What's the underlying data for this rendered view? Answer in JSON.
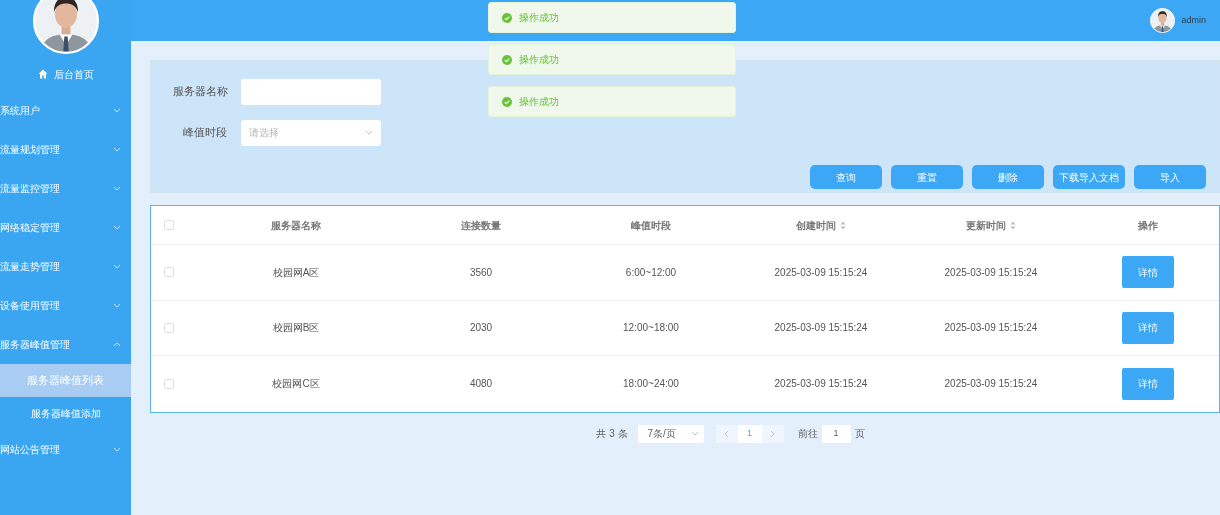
{
  "sidebar": {
    "home": "后台首页",
    "items": [
      {
        "label": "系统用户",
        "expanded": false
      },
      {
        "label": "流量规划管理",
        "expanded": false
      },
      {
        "label": "流量监控管理",
        "expanded": false
      },
      {
        "label": "网络稳定管理",
        "expanded": false
      },
      {
        "label": "流量走势管理",
        "expanded": false
      },
      {
        "label": "设备使用管理",
        "expanded": false
      },
      {
        "label": "服务器峰值管理",
        "expanded": true,
        "children": [
          {
            "label": "服务器峰值列表",
            "selected": true
          },
          {
            "label": "服务器峰值添加",
            "selected": false
          }
        ]
      },
      {
        "label": "网站公告管理",
        "expanded": false
      }
    ]
  },
  "header": {
    "user": "admin"
  },
  "toasts": [
    "操作成功",
    "操作成功",
    "操作成功"
  ],
  "search": {
    "fields": [
      {
        "kind": "input",
        "label": "服务器名称"
      },
      {
        "kind": "select",
        "label": "峰值时段",
        "placeholder": "请选择"
      }
    ],
    "buttons": [
      "查询",
      "重置",
      "删除",
      "下载导入文档",
      "导入"
    ]
  },
  "table": {
    "select_all_checked": false,
    "columns": [
      {
        "label": "服务器名称",
        "sortable": false
      },
      {
        "label": "连接数量",
        "sortable": false
      },
      {
        "label": "峰值时段",
        "sortable": false
      },
      {
        "label": "创建时间",
        "sortable": true
      },
      {
        "label": "更新时间",
        "sortable": true
      },
      {
        "label": "操作",
        "sortable": false
      }
    ],
    "rows": [
      {
        "checked": false,
        "cells": [
          "校园网A区",
          "3560",
          "6:00~12:00",
          "2025-03-09 15:15:24",
          "2025-03-09 15:15:24"
        ],
        "action": "详情"
      },
      {
        "checked": false,
        "cells": [
          "校园网B区",
          "2030",
          "12:00~18:00",
          "2025-03-09 15:15:24",
          "2025-03-09 15:15:24"
        ],
        "action": "详情"
      },
      {
        "checked": false,
        "cells": [
          "校园网C区",
          "4080",
          "18:00~24:00",
          "2025-03-09 15:15:24",
          "2025-03-09 15:15:24"
        ],
        "action": "详情"
      }
    ]
  },
  "pagination": {
    "total": "共 3 条",
    "page_size": "7条/页",
    "pages": [
      {
        "label": "1",
        "selected": true
      }
    ],
    "goto_label": "前往",
    "goto_value": "1",
    "goto_suffix": "页"
  }
}
